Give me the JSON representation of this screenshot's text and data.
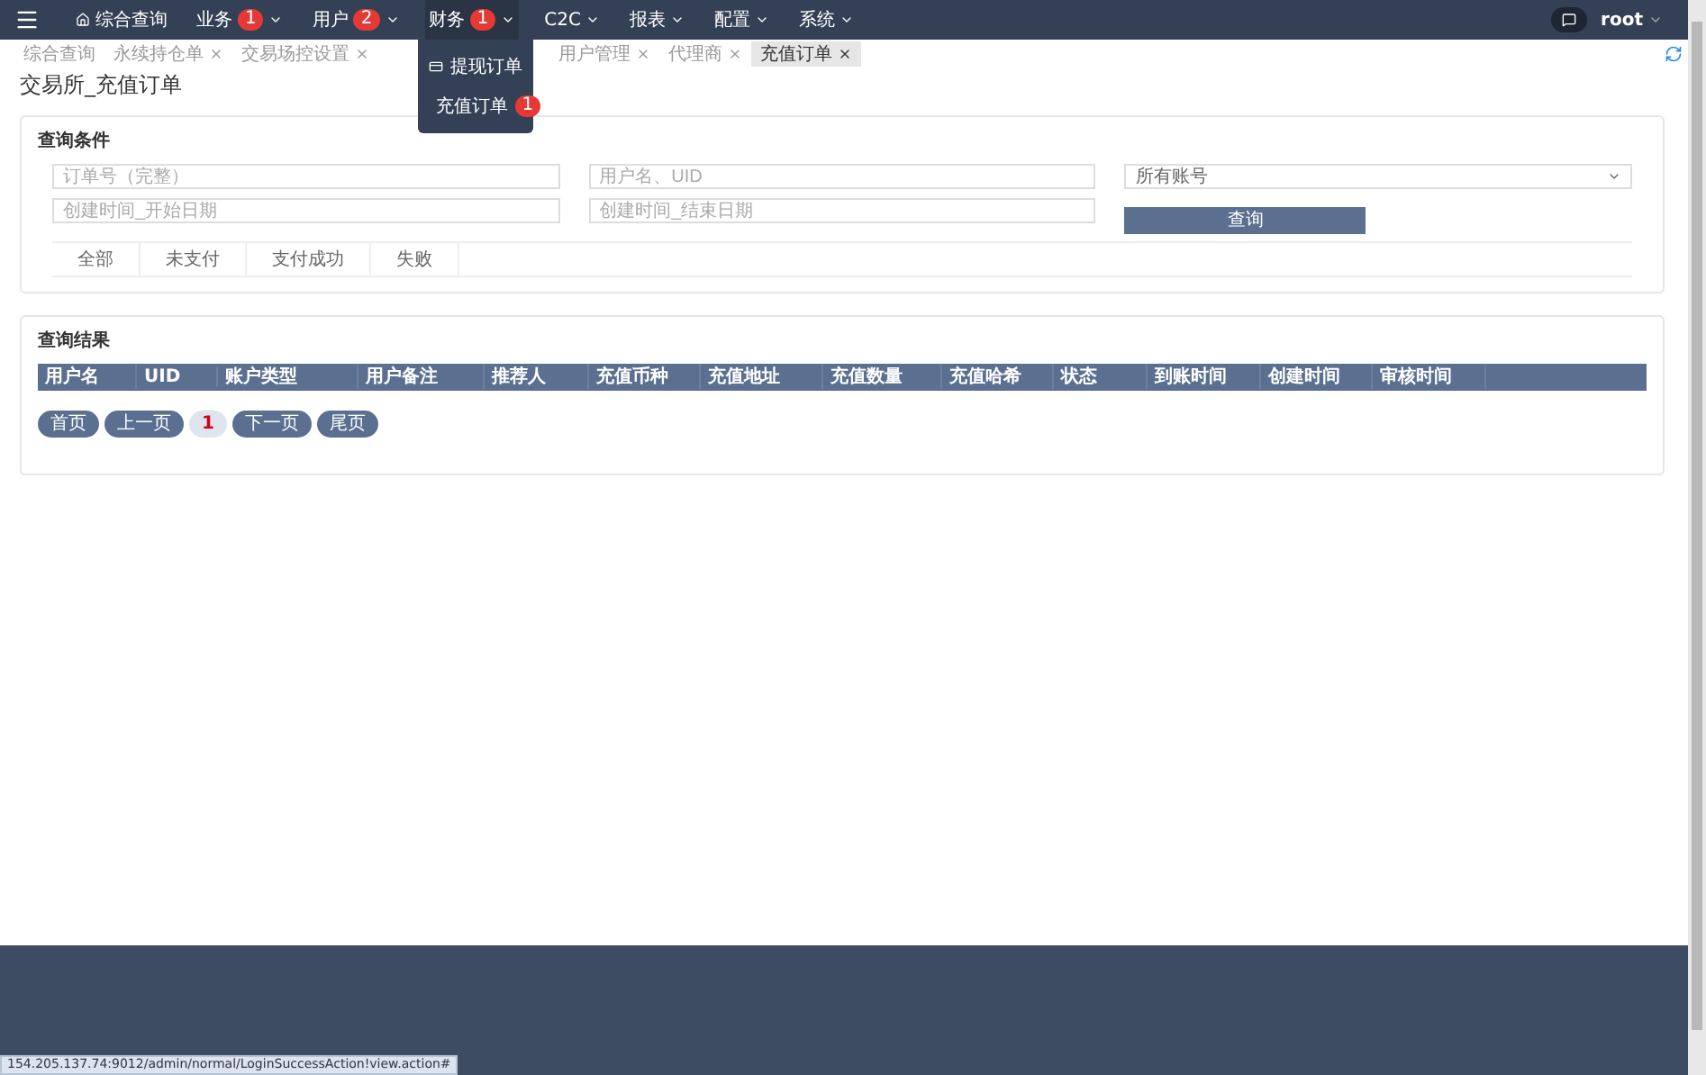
{
  "navbar": {
    "items": [
      {
        "label": "综合查询",
        "kind": "link"
      },
      {
        "label": "业务",
        "badge": "1",
        "kind": "menu"
      },
      {
        "label": "用户",
        "badge": "2",
        "kind": "menu"
      },
      {
        "label": "财务",
        "badge": "1",
        "kind": "menu",
        "expanded": true,
        "menu": [
          {
            "label": "提现订单"
          },
          {
            "label": "充值订单",
            "badge": "1"
          }
        ]
      },
      {
        "label": "C2C",
        "kind": "menu"
      },
      {
        "label": "报表",
        "kind": "menu"
      },
      {
        "label": "配置",
        "kind": "menu"
      },
      {
        "label": "系统",
        "kind": "menu"
      }
    ],
    "user": "root"
  },
  "tabs": [
    {
      "label": "综合查询",
      "closable": false,
      "selected": false
    },
    {
      "label": "永续持仓单",
      "closable": true,
      "selected": false
    },
    {
      "label": "交易场控设置",
      "closable": true,
      "selected": false
    },
    {
      "label": "用户管理",
      "closable": true,
      "selected": false
    },
    {
      "label": "代理商",
      "closable": true,
      "selected": false
    },
    {
      "label": "充值订单",
      "closable": true,
      "selected": true
    }
  ],
  "page_title": "交易所_充值订单",
  "search": {
    "title": "查询条件",
    "order_field": {
      "placeholder": "订单号（完整）"
    },
    "user_field": {
      "placeholder": "用户名、UID"
    },
    "account_select": {
      "value": "所有账号"
    },
    "start_field": {
      "placeholder": "创建时间_开始日期"
    },
    "end_field": {
      "placeholder": "创建时间_结束日期"
    },
    "query_button": "查询",
    "status_tabs": [
      "全部",
      "未支付",
      "支付成功",
      "失败"
    ]
  },
  "results": {
    "title": "查询结果",
    "columns": [
      "用户名",
      "UID",
      "账户类型",
      "用户备注",
      "推荐人",
      "充值币种",
      "充值地址",
      "充值数量",
      "充值哈希",
      "状态",
      "到账时间",
      "创建时间",
      "审核时间"
    ],
    "pager": [
      {
        "label": "首页",
        "selected": false
      },
      {
        "label": "上一页",
        "selected": false
      },
      {
        "label": "1",
        "selected": true
      },
      {
        "label": "下一页",
        "selected": false
      },
      {
        "label": "尾页",
        "selected": false
      }
    ]
  },
  "status_url": "154.205.137.74:9012/admin/normal/LoginSuccessAction!view.action#"
}
